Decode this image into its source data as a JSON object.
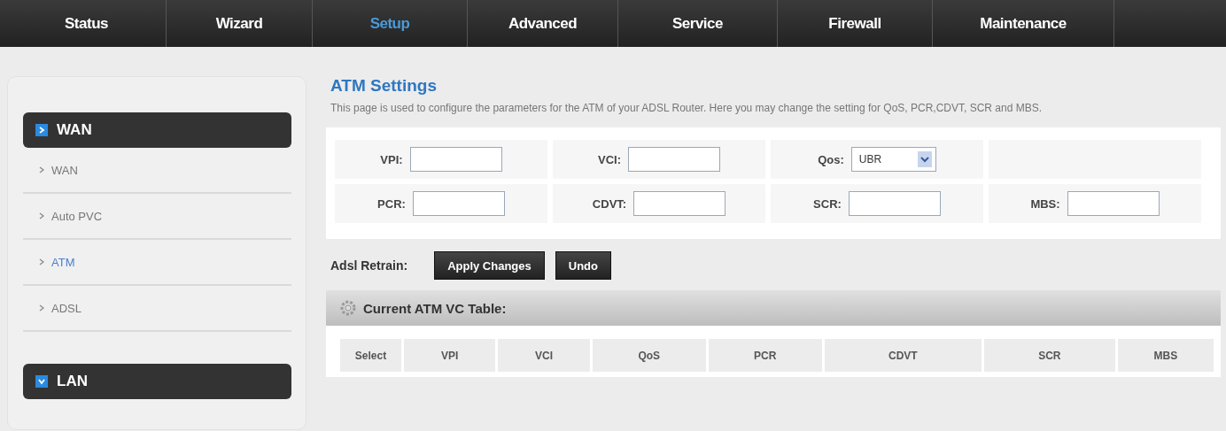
{
  "nav": [
    {
      "label": "Status",
      "selected": false
    },
    {
      "label": "Wizard",
      "selected": false
    },
    {
      "label": "Setup",
      "selected": true
    },
    {
      "label": "Advanced",
      "selected": false
    },
    {
      "label": "Service",
      "selected": false
    },
    {
      "label": "Firewall",
      "selected": false
    },
    {
      "label": "Maintenance",
      "selected": false
    }
  ],
  "sidebar": {
    "groups": [
      {
        "label": "WAN",
        "expanded": true,
        "items": [
          {
            "label": "WAN",
            "selected": false
          },
          {
            "label": "Auto PVC",
            "selected": false
          },
          {
            "label": "ATM",
            "selected": true
          },
          {
            "label": "ADSL",
            "selected": false
          }
        ]
      },
      {
        "label": "LAN",
        "expanded": false
      }
    ]
  },
  "page": {
    "title": "ATM Settings",
    "description": "This page is used to configure the parameters for the ATM of your ADSL Router. Here you may change the setting for QoS, PCR,CDVT, SCR and MBS."
  },
  "form": {
    "rows": [
      [
        {
          "kind": "input",
          "label": "VPI:"
        },
        {
          "kind": "input",
          "label": "VCI:"
        },
        {
          "kind": "select",
          "label": "Qos:",
          "value": "UBR"
        },
        {
          "kind": "empty"
        }
      ],
      [
        {
          "kind": "input",
          "label": "PCR:"
        },
        {
          "kind": "input",
          "label": "CDVT:"
        },
        {
          "kind": "input",
          "label": "SCR:"
        },
        {
          "kind": "input",
          "label": "MBS:"
        }
      ]
    ]
  },
  "actions": {
    "label": "Adsl Retrain:",
    "buttons": [
      "Apply Changes",
      "Undo"
    ]
  },
  "table": {
    "title": "Current ATM VC Table:",
    "columns": [
      "Select",
      "VPI",
      "VCI",
      "QoS",
      "PCR",
      "CDVT",
      "SCR",
      "MBS"
    ]
  }
}
